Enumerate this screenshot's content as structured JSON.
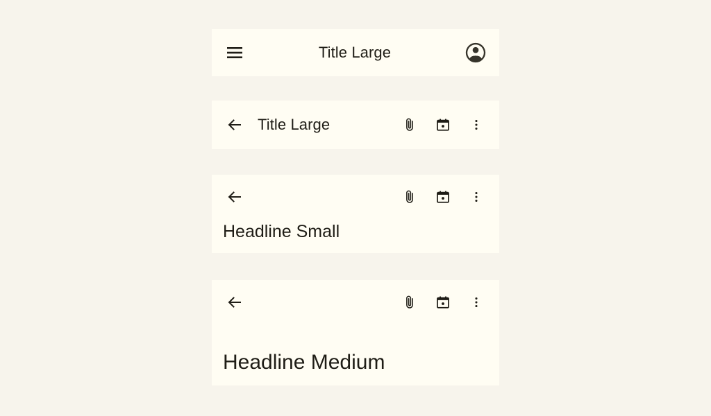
{
  "page": {
    "background_color": "#F7F4EC",
    "surface_color": "#FFFDF3",
    "text_color": "#1F1D16"
  },
  "bars": {
    "center_aligned": {
      "title": "Title Large",
      "menu_icon": "hamburger-menu-icon",
      "avatar_icon": "account-circle-icon"
    },
    "small": {
      "title": "Title Large",
      "back_icon": "arrow-back-icon",
      "actions": [
        "attach-file-icon",
        "calendar-today-icon",
        "more-vert-icon"
      ]
    },
    "medium": {
      "headline": "Headline Small",
      "back_icon": "arrow-back-icon",
      "actions": [
        "attach-file-icon",
        "calendar-today-icon",
        "more-vert-icon"
      ]
    },
    "large": {
      "headline": "Headline Medium",
      "back_icon": "arrow-back-icon",
      "actions": [
        "attach-file-icon",
        "calendar-today-icon",
        "more-vert-icon"
      ]
    }
  }
}
